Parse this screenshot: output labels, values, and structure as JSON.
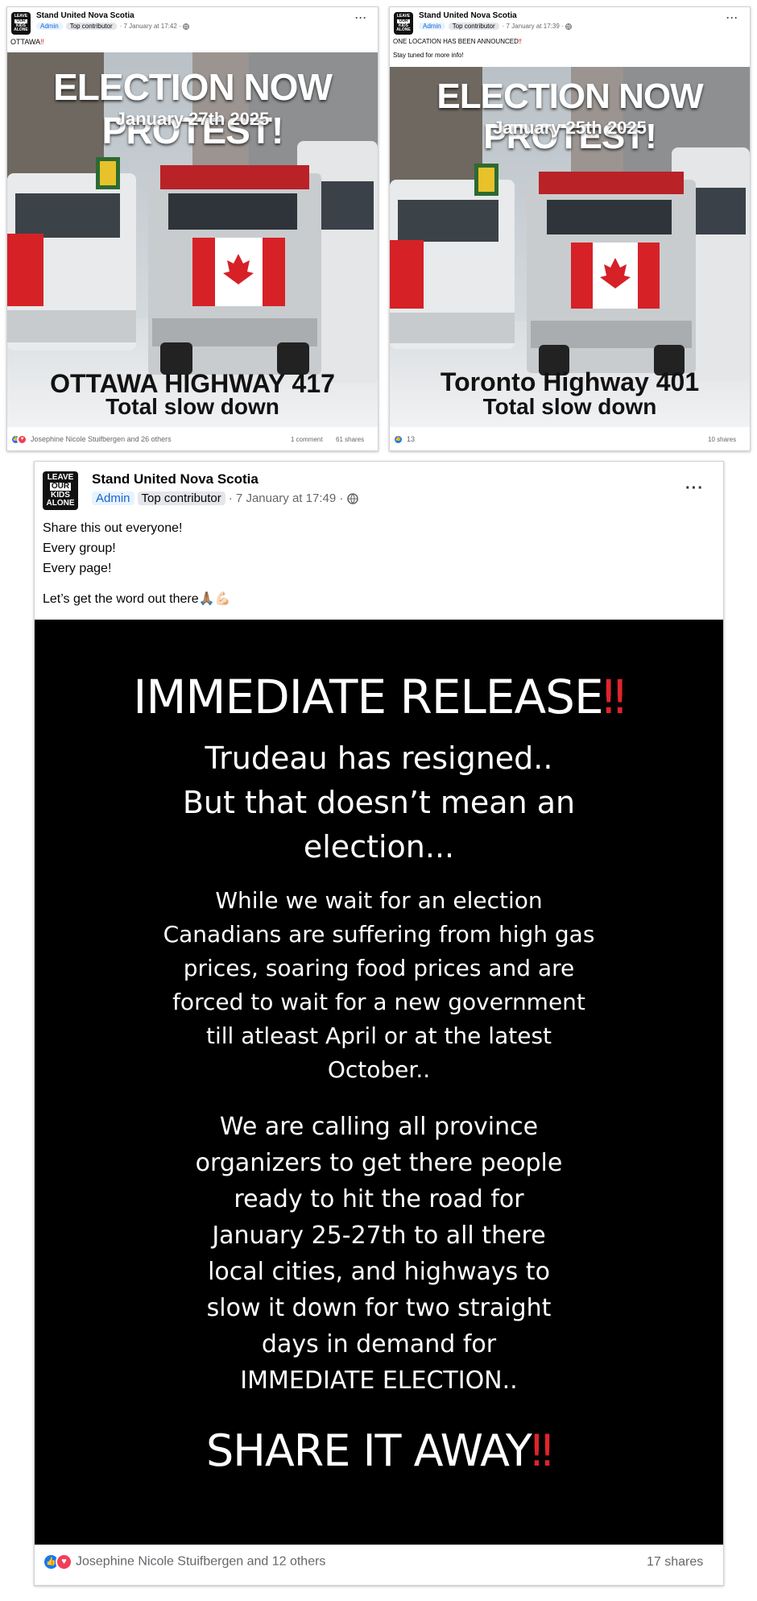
{
  "posts": {
    "post1": {
      "page_name": "Stand United Nova Scotia",
      "badge_admin": "Admin",
      "badge_top": "Top contributor",
      "time": "· 7 January at 17:42 ·",
      "text": "OTTAWA",
      "poster": {
        "title": "ELECTION NOW PROTEST!",
        "date": "January 27th 2025",
        "location": "OTTAWA HIGHWAY 417",
        "tagline": "Total slow down"
      },
      "reactions_text": "Josephine Nicole Stuifbergen and 26 others",
      "comments": "1 comment",
      "shares": "61 shares"
    },
    "post2": {
      "page_name": "Stand United Nova Scotia",
      "badge_admin": "Admin",
      "badge_top": "Top contributor",
      "time": "· 7 January at 17:39 ·",
      "text_line1": "ONE LOCATION HAS BEEN ANNOUNCED",
      "text_line2": "Stay tuned for more info!",
      "poster": {
        "title": "ELECTION NOW PROTEST!",
        "date": "January 25th 2025",
        "location": "Toronto Highway 401",
        "tagline": "Total slow down"
      },
      "reactions_count": "13",
      "shares": "10 shares"
    },
    "post3": {
      "page_name": "Stand United Nova Scotia",
      "badge_admin": "Admin",
      "badge_top": "Top contributor",
      "time": "· 7 January at 17:49 ·",
      "text_lines": [
        "Share this out everyone!",
        "Every group!",
        "Every page!",
        "Let’s get the word out there🙏🏽💪🏻"
      ],
      "image": {
        "headline": "IMMEDIATE RELEASE",
        "sub1": "Trudeau has resigned..",
        "sub2": "But that doesn’t mean an",
        "sub3": "election...",
        "para1": [
          "While we wait for an election",
          "Canadians are suffering from high gas",
          "prices, soaring food prices and are",
          "forced to wait for a new government",
          "till atleast April or at the latest",
          "October.."
        ],
        "para2": [
          "We are calling all province",
          "organizers to get there people",
          "ready to hit the road for",
          "January 25-27th to all there",
          "local cities, and highways to",
          "slow it down for two straight",
          "days in demand for",
          "IMMEDIATE ELECTION.."
        ],
        "footer": "SHARE IT AWAY"
      },
      "reactions_text": "Josephine Nicole Stuifbergen and 12 others",
      "shares": "17 shares"
    }
  },
  "logo": {
    "line1": "LEAVE",
    "line2": "OUR",
    "line3": "KIDS",
    "line4": "ALONE"
  },
  "icons": {
    "bang": "‼",
    "globe": "globe-icon",
    "more": "more-icon"
  },
  "colors": {
    "admin_badge": "#1763cf",
    "like": "#1877f2",
    "love": "#f33e58",
    "bang": "#e0242b"
  }
}
